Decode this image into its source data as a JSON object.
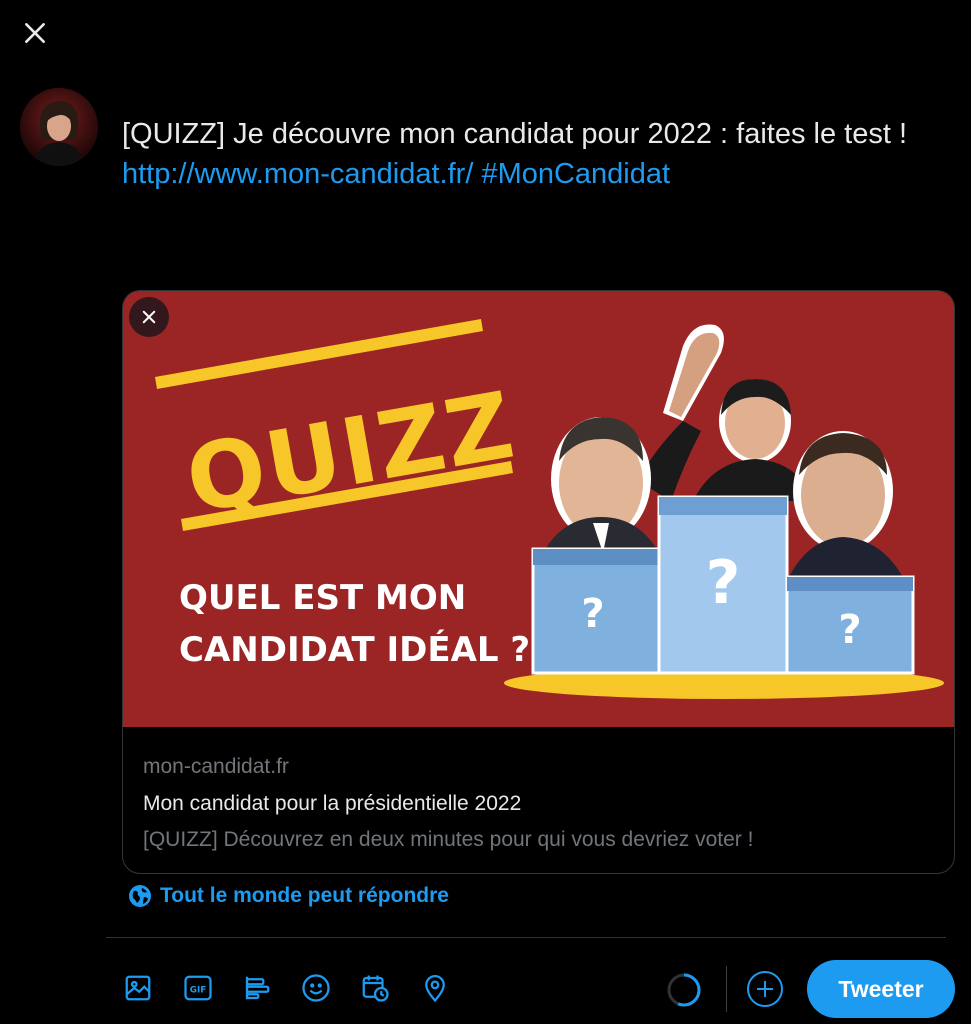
{
  "colors": {
    "accent": "#1d9bf0",
    "background": "#000000",
    "card_bg": "#9b2524",
    "quizz_yellow": "#f7c628"
  },
  "compose": {
    "close_icon": "close-icon",
    "text_plain": "[QUIZZ] Je découvre mon candidat pour 2022 : faites le test ! ",
    "link_url": "http://www.mon-candidat.fr/",
    "hashtag": "#MonCandidat"
  },
  "card": {
    "image": {
      "headline": "QUIZZ",
      "subtitle_line1": "QUEL EST MON",
      "subtitle_line2": "CANDIDAT IDÉAL ?",
      "podium_marks": [
        "?",
        "?",
        "?"
      ]
    },
    "domain": "mon-candidat.fr",
    "title": "Mon candidat pour la présidentielle 2022",
    "description": "[QUIZZ] Découvrez en deux minutes pour qui vous devriez voter !"
  },
  "reply_setting": {
    "label": "Tout le monde peut répondre",
    "icon": "globe-icon"
  },
  "toolbar": {
    "icons": [
      "image-icon",
      "gif-icon",
      "poll-icon",
      "emoji-icon",
      "schedule-icon",
      "location-icon"
    ],
    "gif_label": "GIF",
    "add_icon": "plus-circle-icon",
    "submit_label": "Tweeter"
  }
}
